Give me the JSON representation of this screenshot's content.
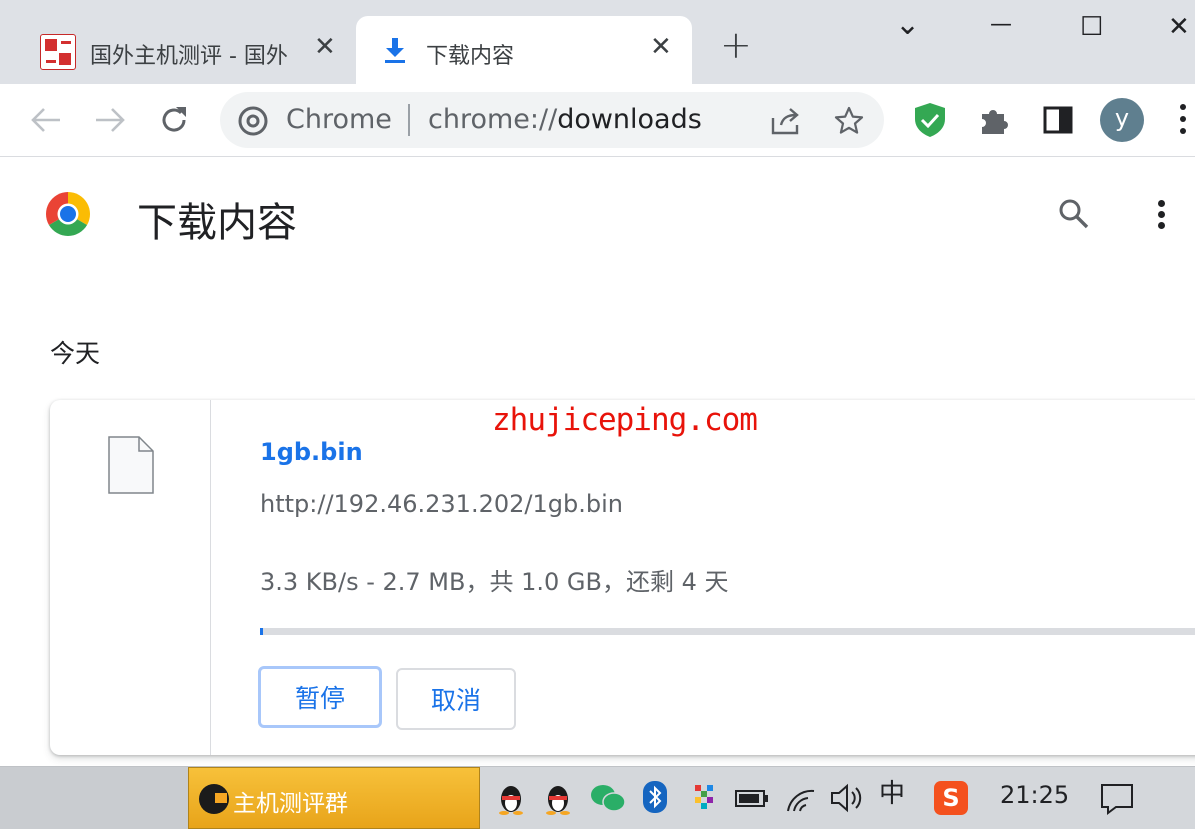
{
  "tabs": [
    {
      "title": "国外主机测评 - 国外",
      "close": "✕"
    },
    {
      "title": "下载内容",
      "close": "✕"
    }
  ],
  "new_tab": "+",
  "window_controls": {
    "menu": "⌄",
    "minimize": "—",
    "maximize": "☐",
    "close": "✕"
  },
  "omnibox": {
    "origin": "Chrome",
    "scheme": "chrome://",
    "path": "downloads"
  },
  "profile_initial": "y",
  "page": {
    "title": "下载内容",
    "date_header": "今天"
  },
  "watermark": "zhujiceping.com",
  "download": {
    "filename": "1gb.bin",
    "url": "http://192.46.231.202/1gb.bin",
    "status": "3.3 KB/s - 2.7 MB，共 1.0 GB，还剩 4 天",
    "progress": 0.0027,
    "pause_label": "暂停",
    "cancel_label": "取消"
  },
  "taskbar": {
    "group_label": "主机测评群",
    "ime": "中",
    "clock": "21:25"
  },
  "colors": {
    "accent": "#1a73e8",
    "shield": "#34a853",
    "watermark": "#e8130a"
  }
}
